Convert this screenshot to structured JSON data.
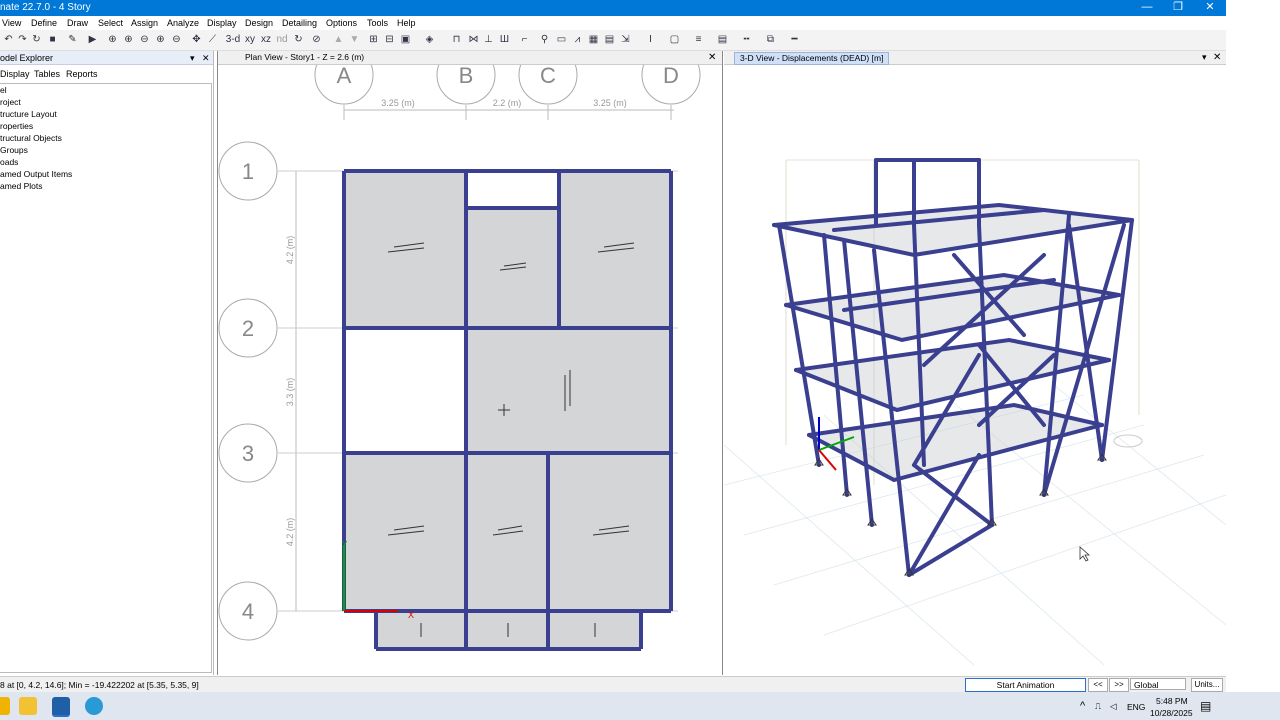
{
  "window": {
    "title": "nate 22.7.0 - 4 Story",
    "min_glyph": "—",
    "restore_glyph": "❐",
    "close_glyph": "✕"
  },
  "menu": [
    "View",
    "Define",
    "Draw",
    "Select",
    "Assign",
    "Analyze",
    "Display",
    "Design",
    "Detailing",
    "Options",
    "Tools",
    "Help"
  ],
  "toolbar": {
    "icons": [
      "undo-icon",
      "redo-icon",
      "lock-icon",
      "pencil-icon",
      "run-icon",
      "zoom-window-icon",
      "zoom-in-icon",
      "zoom-out-icon",
      "pan-icon",
      "zoom-previous-icon",
      "3d-view-icon",
      "plan-view-icon",
      "elevation-view-icon",
      "rotate-icon",
      "object-shrink-icon",
      "up-icon",
      "down-icon",
      "select-icon",
      "options-icon",
      "draw-frame-icon",
      "draw-brace-icon",
      "draw-column-icon",
      "draw-beam-icon",
      "draw-wall-icon",
      "draw-support-icon",
      "draw-slab-icon",
      "deck-icon",
      "opening-icon",
      "grid-icon",
      "section-icon",
      "assign-joint-icon",
      "assign-frame-icon",
      "assign-shell-icon",
      "display-icon",
      "line-style-icon"
    ],
    "view_3d_label": "3-d",
    "plan_label": "xy",
    "elev_label": "nd"
  },
  "explorer": {
    "title": "odel Explorer",
    "tabs": [
      "Display",
      "Tables",
      "Reports"
    ],
    "tree": [
      "el",
      "roject",
      "tructure Layout",
      "roperties",
      "tructural Objects",
      "Groups",
      "oads",
      "amed Output Items",
      "amed Plots"
    ]
  },
  "plan_view": {
    "tab": "Plan View - Story1 - Z = 2.6 (m)",
    "grid_columns": [
      "A",
      "B",
      "C",
      "D"
    ],
    "grid_rows": [
      "1",
      "2",
      "3",
      "4"
    ],
    "col_dims": [
      "3.25 (m)",
      "2.2 (m)",
      "3.25 (m)"
    ],
    "row_dims": [
      "4.2 (m)",
      "3.3 (m)",
      "4.2 (m)"
    ],
    "axis_x": "X",
    "axis_y": "Y"
  },
  "view_3d": {
    "tab": "3-D View  - Displacements (DEAD)  [m]"
  },
  "status": {
    "text": "8 at [0, 4.2, 14.6];  Min = -19.422202 at [5.35, 5.35, 9]",
    "animation_button": "Start Animation",
    "prev": "<<",
    "next": ">>",
    "coord_system": "Global",
    "units": "Units..."
  },
  "taskbar": {
    "time": "5:48 PM",
    "date": "10/28/2025",
    "lang": "ENG",
    "up_arrow": "^"
  },
  "colors": {
    "title_bar": "#0078d7",
    "frame": "#3a3f8f",
    "slab": "#d3d5d6",
    "grid": "#9a9a9a"
  }
}
